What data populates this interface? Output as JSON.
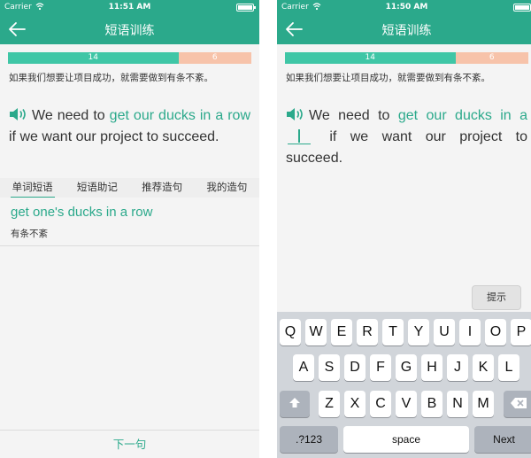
{
  "left": {
    "status": {
      "carrier": "Carrier",
      "time": "11:51 AM"
    },
    "nav": {
      "title": "短语训练"
    },
    "progress": {
      "done": "14",
      "remaining": "6"
    },
    "hint_cn": "如果我们想要让项目成功，就需要做到有条不紊。",
    "sentence": {
      "pre": "We need to ",
      "phrase": "get our ducks in a row",
      "post": " if we want our project to succeed."
    },
    "tabs": [
      "单词短语",
      "短语助记",
      "推荐造句",
      "我的造句"
    ],
    "phrase_card": {
      "en": "get one's ducks in a row",
      "cn": "有条不紊"
    },
    "next_label": "下一句"
  },
  "right": {
    "status": {
      "carrier": "Carrier",
      "time": "11:50 AM"
    },
    "nav": {
      "title": "短语训练"
    },
    "progress": {
      "done": "14",
      "remaining": "6"
    },
    "hint_cn": "如果我们想要让项目成功，就需要做到有条不紊。",
    "sentence": {
      "pre": "We need to ",
      "phrase": "get our ducks in a",
      "post": " if we want our project to succeed."
    },
    "tip_label": "提示",
    "keyboard": {
      "row1": [
        "Q",
        "W",
        "E",
        "R",
        "T",
        "Y",
        "U",
        "I",
        "O",
        "P"
      ],
      "row2": [
        "A",
        "S",
        "D",
        "F",
        "G",
        "H",
        "J",
        "K",
        "L"
      ],
      "row3": [
        "Z",
        "X",
        "C",
        "V",
        "B",
        "N",
        "M"
      ],
      "numbers": ".?123",
      "space": "space",
      "next": "Next"
    }
  },
  "colors": {
    "brand": "#2ba98b",
    "progress_done": "#3fc6a6",
    "progress_remaining": "#f7c3aa"
  }
}
